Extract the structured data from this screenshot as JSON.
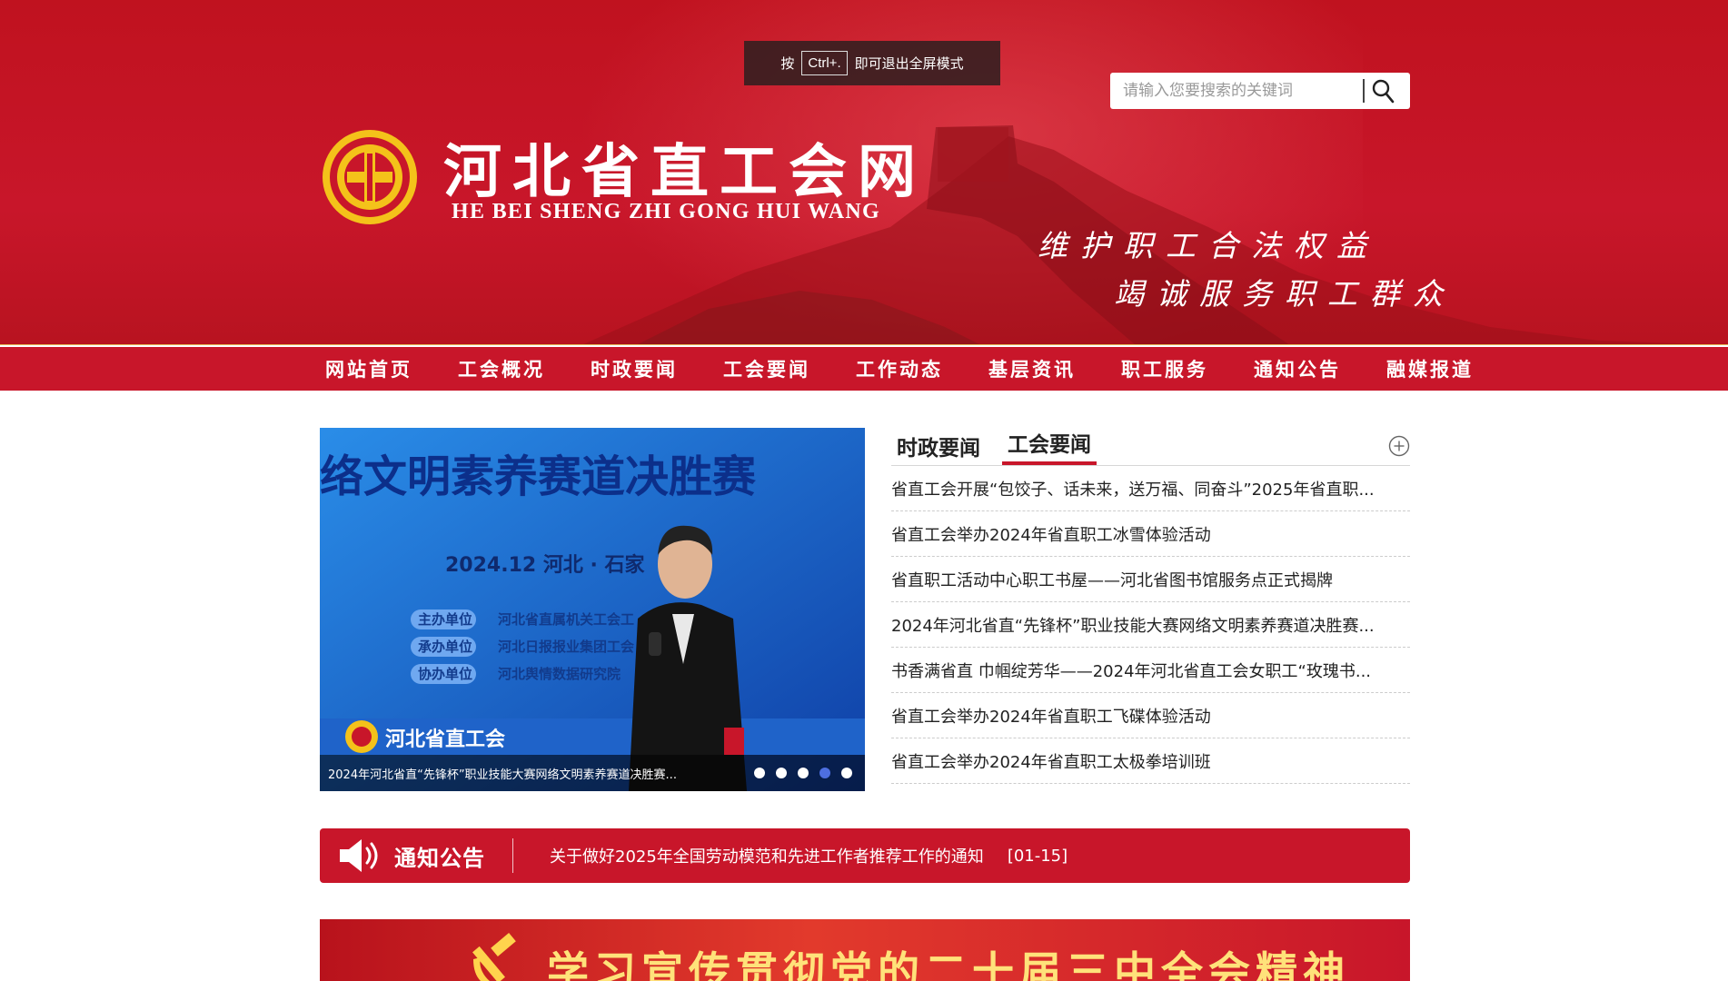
{
  "fullscreen_tip": {
    "prefix": "按",
    "key": "Ctrl+.",
    "suffix": "即可退出全屏模式"
  },
  "search": {
    "placeholder": "请输入您要搜索的关键词"
  },
  "header": {
    "title": "河北省直工会网",
    "subtitle": "HE BEI SHENG ZHI GONG HUI WANG",
    "slogan_line1": "维护职工合法权益",
    "slogan_line2": "竭诚服务职工群众"
  },
  "nav": {
    "items": [
      {
        "label": "网站首页"
      },
      {
        "label": "工会概况"
      },
      {
        "label": "时政要闻"
      },
      {
        "label": "工会要闻"
      },
      {
        "label": "工作动态"
      },
      {
        "label": "基层资讯"
      },
      {
        "label": "职工服务"
      },
      {
        "label": "通知公告"
      },
      {
        "label": "融媒报道"
      }
    ]
  },
  "carousel": {
    "caption": "2024年河北省直“先锋杯”职业技能大赛网络文明素养赛道决胜赛...",
    "slide_text": {
      "headline": "络文明素养赛道决胜赛",
      "date_place": "2024.12  河北 · 石家",
      "roles": [
        "主办单位",
        "承办单位",
        "协办单位"
      ],
      "orgs": [
        "河北省直属机关工会工",
        "河北日报报业集团工会",
        "河北舆情数据研究院"
      ],
      "bottom_logo": "河北省直工会"
    },
    "dots": 5,
    "active_dot": 4
  },
  "news": {
    "tabs": [
      {
        "label": "时政要闻"
      },
      {
        "label": "工会要闻"
      }
    ],
    "active_tab": 1,
    "items": [
      "省直工会开展“包饺子、话未来，送万福、同奋斗”2025年省直职...",
      "省直工会举办2024年省直职工冰雪体验活动",
      "省直职工活动中心职工书屋——河北省图书馆服务点正式揭牌",
      "2024年河北省直“先锋杯”职业技能大赛网络文明素养赛道决胜赛...",
      "书香满省直 巾帼绽芳华——2024年河北省直工会女职工“玫瑰书...",
      "省直工会举办2024年省直职工飞碟体验活动",
      "省直工会举办2024年省直职工太极拳培训班"
    ]
  },
  "notice": {
    "title": "通知公告",
    "text": "关于做好2025年全国劳动模范和先进工作者推荐工作的通知",
    "date": "[01-15]"
  },
  "banner": {
    "text": "学习宣传贯彻党的二十届三中全会精神"
  },
  "colors": {
    "brand_red": "#c8162a",
    "gold": "#e5b453",
    "slogan_white": "#ffffff",
    "banner_text": "#ffe27a"
  }
}
